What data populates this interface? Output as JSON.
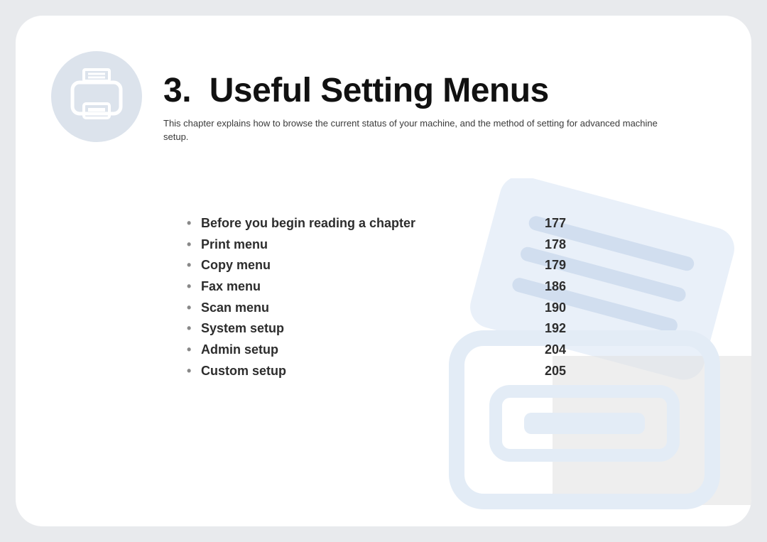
{
  "chapter": {
    "number": "3.",
    "title": "Useful Setting Menus",
    "description": "This chapter explains how to browse the current status of your machine, and the method of setting for advanced machine setup."
  },
  "toc": [
    {
      "label": "Before you begin reading a chapter",
      "page": "177"
    },
    {
      "label": "Print menu",
      "page": "178"
    },
    {
      "label": "Copy menu",
      "page": "179"
    },
    {
      "label": "Fax menu",
      "page": "186"
    },
    {
      "label": "Scan menu",
      "page": "190"
    },
    {
      "label": "System setup",
      "page": "192"
    },
    {
      "label": "Admin setup",
      "page": "204"
    },
    {
      "label": "Custom setup",
      "page": "205"
    }
  ]
}
